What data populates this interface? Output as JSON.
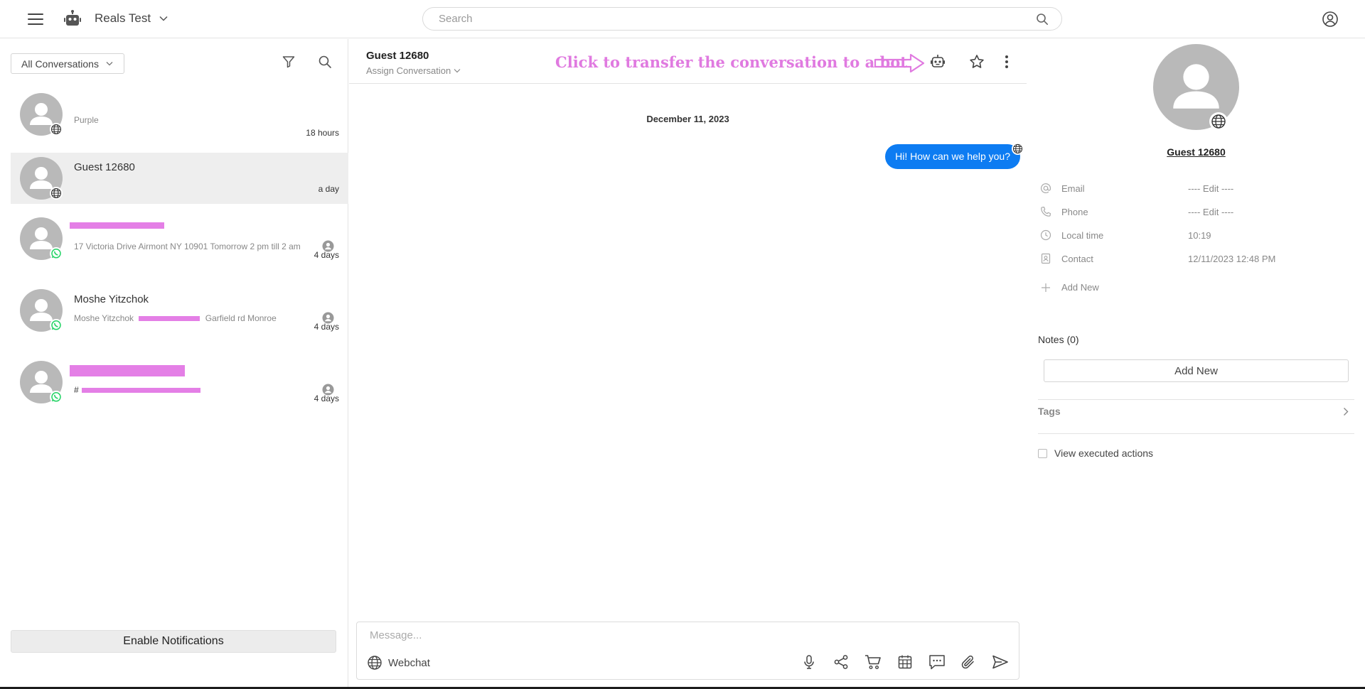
{
  "topbar": {
    "workspace_name": "Reals Test",
    "search_placeholder": "Search"
  },
  "left_panel": {
    "filter_label": "All Conversations",
    "conversations": [
      {
        "name": "",
        "preview": "Purple",
        "time": "18 hours",
        "channel": "webchat",
        "selected": false
      },
      {
        "name": "Guest 12680",
        "preview": "",
        "time": "a day",
        "channel": "webchat",
        "selected": true
      },
      {
        "name": "",
        "preview": "17 Victoria Drive Airmont NY 10901 Tomorrow 2 pm till 2 am",
        "time": "4 days",
        "channel": "whatsapp",
        "selected": false
      },
      {
        "name": "Moshe Yitzchok",
        "preview": "Moshe Yitzchok",
        "preview_suffix": "Garfield rd Monroe",
        "time": "4 days",
        "channel": "whatsapp",
        "selected": false
      },
      {
        "name": "",
        "preview": "#",
        "time": "4 days",
        "channel": "whatsapp",
        "selected": false
      }
    ],
    "enable_notifications_label": "Enable Notifications"
  },
  "chat": {
    "title": "Guest 12680",
    "assign_label": "Assign Conversation",
    "annotation_text": "Click to transfer the conversation to a bot",
    "date_separator": "December 11, 2023",
    "messages": [
      {
        "text": "Hi! How can we help you?",
        "direction": "outgoing"
      }
    ],
    "composer_placeholder": "Message...",
    "channel_label": "Webchat"
  },
  "contact": {
    "name": "Guest 12680",
    "fields": [
      {
        "label": "Email",
        "value": "---- Edit ----",
        "icon": "at-icon"
      },
      {
        "label": "Phone",
        "value": "---- Edit ----",
        "icon": "phone-icon"
      },
      {
        "label": "Local time",
        "value": "10:19",
        "icon": "clock-icon"
      },
      {
        "label": "Contact",
        "value": "12/11/2023 12:48 PM",
        "icon": "contact-card-icon"
      }
    ],
    "add_new_label": "Add New",
    "notes_title": "Notes (0)",
    "notes_add_label": "Add New",
    "tags_label": "Tags",
    "view_executed_label": "View executed actions"
  },
  "colors": {
    "accent_blue": "#0d7cf2",
    "annotation_pink": "#e07ae0",
    "whatsapp_green": "#25d366",
    "avatar_grey": "#b9b9b9"
  }
}
